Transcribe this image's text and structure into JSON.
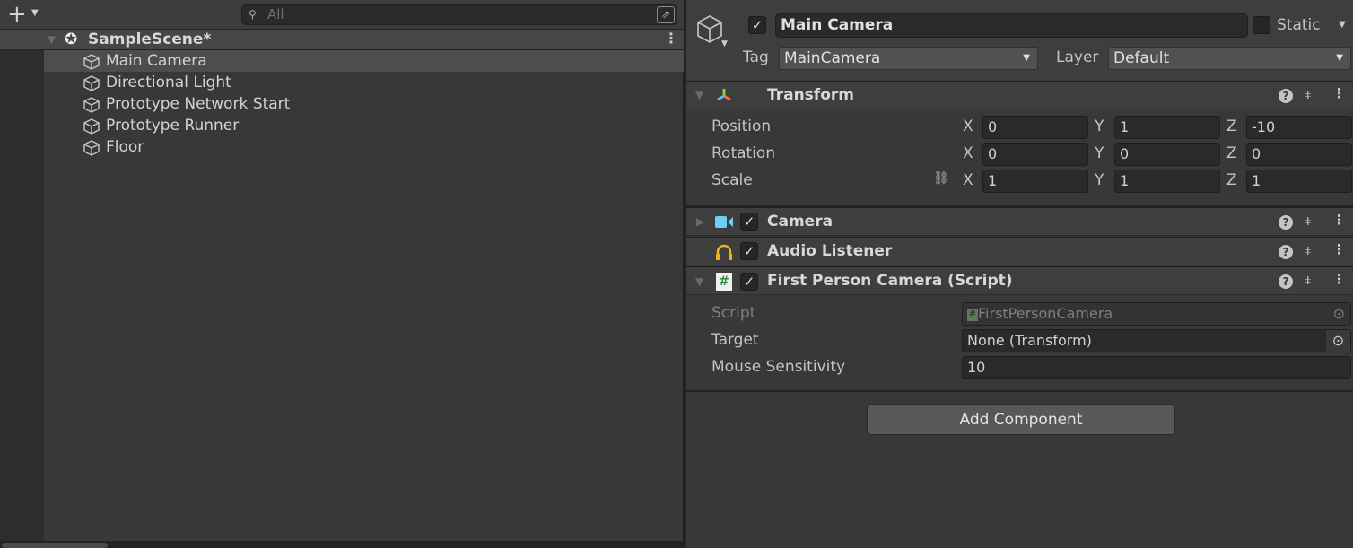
{
  "hierarchy": {
    "add_icon": "plus-icon",
    "search_placeholder": "All",
    "scene": "SampleScene*",
    "items": [
      {
        "label": "Main Camera",
        "selected": true
      },
      {
        "label": "Directional Light"
      },
      {
        "label": "Prototype Network Start"
      },
      {
        "label": "Prototype Runner"
      },
      {
        "label": "Floor"
      }
    ]
  },
  "inspector": {
    "object_name": "Main Camera",
    "active": true,
    "static_label": "Static",
    "static": false,
    "tag_label": "Tag",
    "tag_value": "MainCamera",
    "layer_label": "Layer",
    "layer_value": "Default",
    "transform": {
      "title": "Transform",
      "rows": [
        {
          "label": "Position",
          "x": "0",
          "y": "1",
          "z": "-10"
        },
        {
          "label": "Rotation",
          "x": "0",
          "y": "0",
          "z": "0"
        },
        {
          "label": "Scale",
          "x": "1",
          "y": "1",
          "z": "1"
        }
      ],
      "axes": [
        "X",
        "Y",
        "Z"
      ]
    },
    "camera": {
      "title": "Camera",
      "enabled": true
    },
    "audio": {
      "title": "Audio Listener",
      "enabled": true
    },
    "script": {
      "title": "First Person Camera (Script)",
      "enabled": true,
      "fields": [
        {
          "label": "Script",
          "value": "FirstPersonCamera"
        },
        {
          "label": "Target",
          "value": "None (Transform)"
        },
        {
          "label": "Mouse Sensitivity",
          "value": "10"
        }
      ]
    },
    "add_component": "Add Component",
    "colors": {
      "camera_icon": "#6ccff6",
      "audio_icon": "#f2b01e",
      "script_icon": "#2e8b3e"
    }
  }
}
